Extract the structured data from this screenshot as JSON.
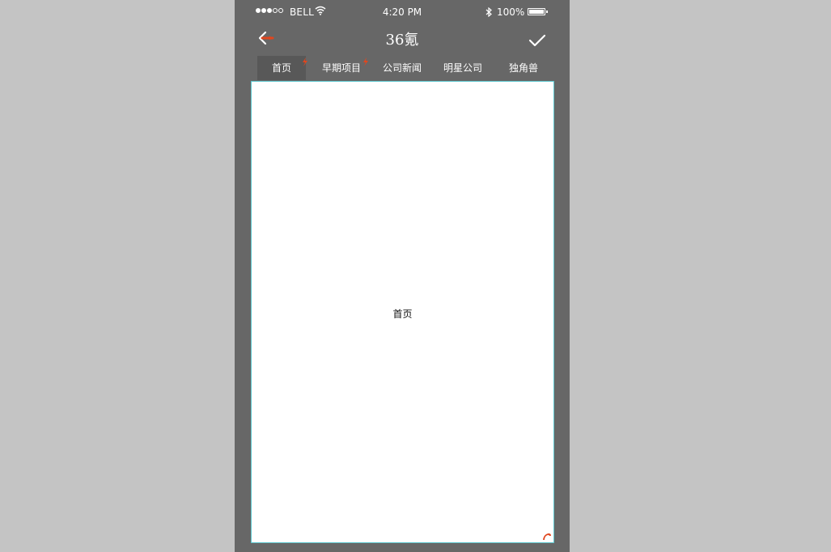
{
  "status_bar": {
    "carrier": "BELL",
    "time": "4:20 PM",
    "battery_percent": "100%",
    "signal_bars_filled": 3,
    "signal_bars_total": 5,
    "battery_level": 1.0
  },
  "nav": {
    "title": "36氪",
    "back_icon": "back-arrow-icon",
    "confirm_icon": "checkmark-icon"
  },
  "tabs": [
    {
      "label": "首页",
      "active": true,
      "badge": true
    },
    {
      "label": "早期项目",
      "active": false,
      "badge": true
    },
    {
      "label": "公司新闻",
      "active": false,
      "badge": false
    },
    {
      "label": "明星公司",
      "active": false,
      "badge": false
    },
    {
      "label": "独角兽",
      "active": false,
      "badge": false
    }
  ],
  "content": {
    "label": "首页"
  },
  "colors": {
    "background": "#c4c4c4",
    "phone": "#676767",
    "active_tab": "#585858",
    "content_border": "#5ec7cf",
    "accent": "#e0461e"
  }
}
